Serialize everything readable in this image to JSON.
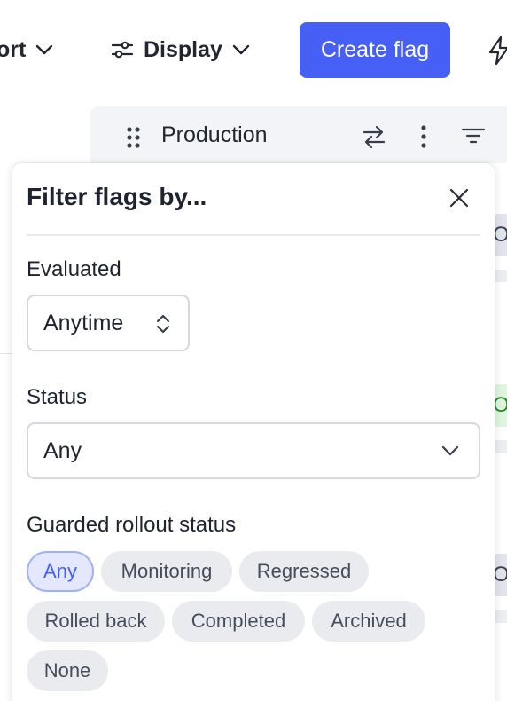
{
  "toolbar": {
    "sort_label": "ort",
    "display_label": "Display",
    "create_flag_label": "Create flag"
  },
  "environment": {
    "name": "Production"
  },
  "background_rows": {
    "row1_status": "Off",
    "row2_status": "On",
    "row3_status": "Off"
  },
  "filter_popover": {
    "title": "Filter flags by...",
    "evaluated": {
      "label": "Evaluated",
      "value": "Anytime"
    },
    "status": {
      "label": "Status",
      "value": "Any"
    },
    "guarded_rollout": {
      "label": "Guarded rollout status",
      "selected": "Any",
      "options": [
        "Any",
        "Monitoring",
        "Regressed",
        "Rolled back",
        "Completed",
        "Archived",
        "None"
      ]
    }
  },
  "colors": {
    "primary": "#4660f5",
    "chip_bg": "#e9ebef",
    "chip_active_bg": "#e3e8fe",
    "env_bar_bg": "#f3f4f7"
  }
}
